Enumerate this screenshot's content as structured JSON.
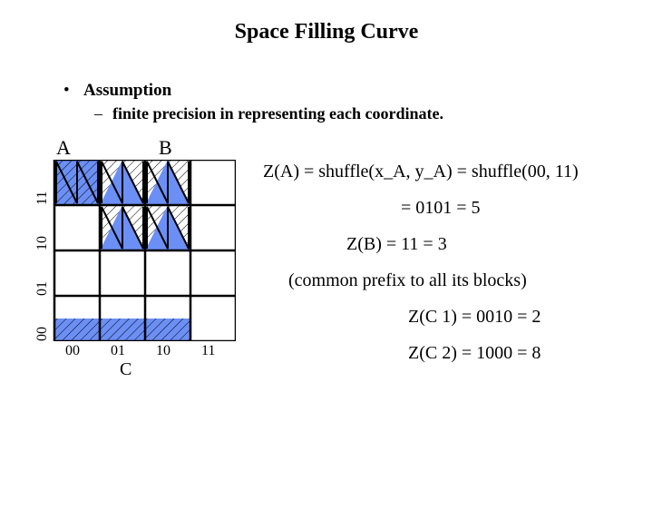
{
  "title": "Space Filling Curve",
  "bullet": "Assumption",
  "subline": "finite precision in representing each coordinate.",
  "grid": {
    "label_A": "A",
    "label_B": "B",
    "y_ticks": [
      "11",
      "10",
      "01",
      "00"
    ],
    "x_ticks": [
      "00",
      "01",
      "10",
      "11"
    ],
    "label_C": "C"
  },
  "eq": {
    "line1": "Z(A) = shuffle(x_A, y_A) = shuffle(00, 11)",
    "line2": "= 0101 = 5",
    "line3": "Z(B) = 11 = 3",
    "line4": "(common prefix to all its blocks)",
    "line5": "Z(C 1) = 0010 = 2",
    "line6": "Z(C 2) = 1000 = 8"
  }
}
